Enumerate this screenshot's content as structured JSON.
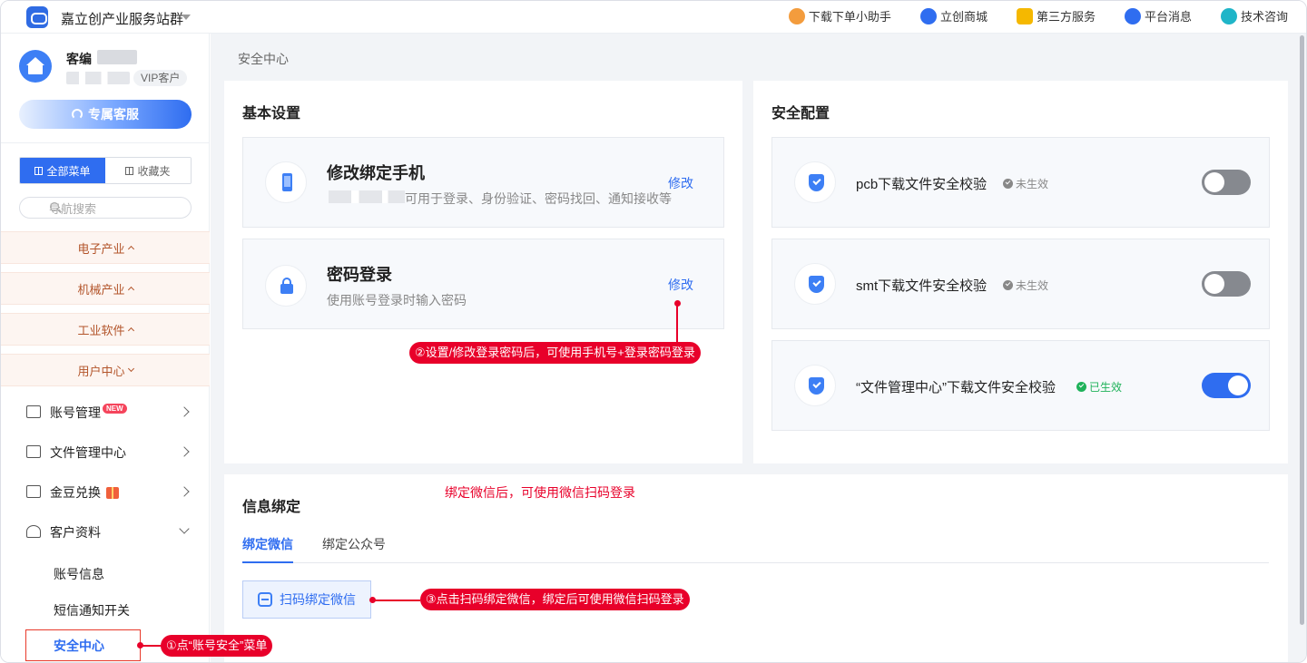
{
  "topbar": {
    "title": "嘉立创产业服务站群",
    "nav": [
      {
        "label": "下载下单小助手",
        "icon": "helper-icon",
        "color": "#f39c3d"
      },
      {
        "label": "立创商城",
        "icon": "mall-icon",
        "color": "#2f6df0"
      },
      {
        "label": "第三方服务",
        "icon": "apps-icon",
        "color": "#f5b800"
      },
      {
        "label": "平台消息",
        "icon": "bell-icon",
        "color": "#2f6df0"
      },
      {
        "label": "技术咨询",
        "icon": "chat-icon",
        "color": "#1fb5c8"
      }
    ]
  },
  "sidebar": {
    "user_name": "客编",
    "vip": "VIP客户",
    "service_button": "专属客服",
    "tabs": [
      "全部菜单",
      "收藏夹"
    ],
    "search_placeholder": "导航搜索",
    "categories": [
      "电子产业",
      "机械产业",
      "工业软件",
      "用户中心"
    ],
    "menu": [
      {
        "label": "账号管理",
        "badge": "NEW"
      },
      {
        "label": "文件管理中心"
      },
      {
        "label": "金豆兑换"
      },
      {
        "label": "客户资料"
      }
    ],
    "submenu": [
      "账号信息",
      "短信通知开关",
      "安全中心"
    ]
  },
  "main": {
    "breadcrumb": "安全中心",
    "basic": {
      "title": "基本设置",
      "phone_title": "修改绑定手机",
      "phone_desc": "可用于登录、身份验证、密码找回、通知接收等",
      "password_title": "密码登录",
      "password_desc": "使用账号登录时输入密码",
      "edit": "修改"
    },
    "security": {
      "title": "安全配置",
      "items": [
        {
          "label": "pcb下载文件安全校验",
          "status": "未生效",
          "enabled": false
        },
        {
          "label": "smt下载文件安全校验",
          "status": "未生效",
          "enabled": false
        },
        {
          "label": "“文件管理中心”下载文件安全校验",
          "status": "已生效",
          "enabled": true
        }
      ]
    },
    "binding": {
      "title": "信息绑定",
      "tabs": [
        "绑定微信",
        "绑定公众号"
      ],
      "scan_button": "扫码绑定微信"
    }
  },
  "annotations": {
    "step1": "①点“账号安全”菜单",
    "step2": "②设置/修改登录密码后，可使用手机号+登录密码登录",
    "step3": "③点击扫码绑定微信，绑定后可使用微信扫码登录",
    "wechat_note": "绑定微信后，可使用微信扫码登录"
  },
  "colors": {
    "accent": "#2f6df0",
    "annotation": "#e8002a",
    "inactive_status": "#888888",
    "active_status": "#1fb25a"
  }
}
